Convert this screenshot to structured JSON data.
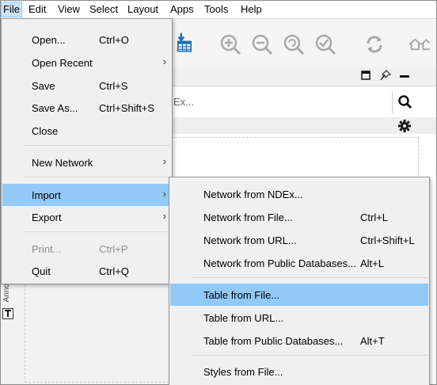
{
  "menubar": [
    "File",
    "Edit",
    "View",
    "Select",
    "Layout",
    "Apps",
    "Tools",
    "Help"
  ],
  "search": {
    "placeholder": "Ex..."
  },
  "left_strip": {
    "label": "Anno"
  },
  "file_menu": {
    "open": {
      "label": "Open...",
      "shortcut": "Ctrl+O"
    },
    "open_recent": {
      "label": "Open Recent"
    },
    "save": {
      "label": "Save",
      "shortcut": "Ctrl+S"
    },
    "save_as": {
      "label": "Save As...",
      "shortcut": "Ctrl+Shift+S"
    },
    "close": {
      "label": "Close"
    },
    "new_network": {
      "label": "New Network"
    },
    "import": {
      "label": "Import"
    },
    "export": {
      "label": "Export"
    },
    "print": {
      "label": "Print...",
      "shortcut": "Ctrl+P"
    },
    "quit": {
      "label": "Quit",
      "shortcut": "Ctrl+Q"
    }
  },
  "import_menu": {
    "net_ndex": {
      "label": "Network from NDEx..."
    },
    "net_file": {
      "label": "Network from File...",
      "shortcut": "Ctrl+L"
    },
    "net_url": {
      "label": "Network from URL...",
      "shortcut": "Ctrl+Shift+L"
    },
    "net_db": {
      "label": "Network from Public Databases...",
      "shortcut": "Alt+L"
    },
    "tbl_file": {
      "label": "Table from File..."
    },
    "tbl_url": {
      "label": "Table from URL..."
    },
    "tbl_db": {
      "label": "Table from Public Databases...",
      "shortcut": "Alt+T"
    },
    "styles_file": {
      "label": "Styles from File..."
    }
  },
  "colors": {
    "highlight": "#91c9f7",
    "active_menu": "#cce4f7",
    "toolbar_icon": "#a9a9a9",
    "import_icon": "#1f6fb5"
  }
}
